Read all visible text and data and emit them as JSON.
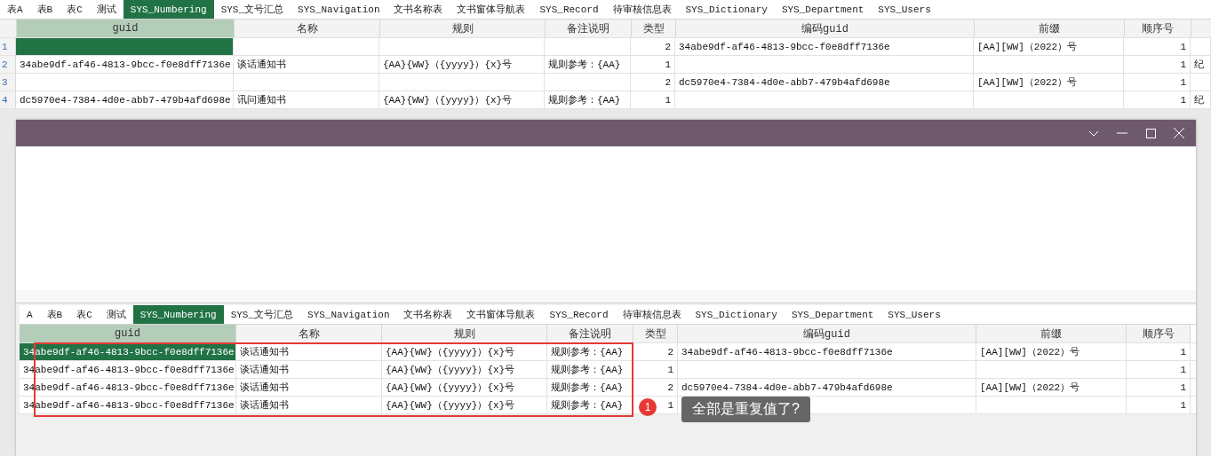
{
  "top_sheet": {
    "tabs": [
      {
        "label": "表A",
        "selected": false
      },
      {
        "label": "表B",
        "selected": false
      },
      {
        "label": "表C",
        "selected": false
      },
      {
        "label": "测试",
        "selected": false
      },
      {
        "label": "SYS_Numbering",
        "selected": true
      },
      {
        "label": "SYS_文号汇总",
        "selected": false
      },
      {
        "label": "SYS_Navigation",
        "selected": false
      },
      {
        "label": "文书名称表",
        "selected": false
      },
      {
        "label": "文书窗体导航表",
        "selected": false
      },
      {
        "label": "SYS_Record",
        "selected": false
      },
      {
        "label": "待审核信息表",
        "selected": false
      },
      {
        "label": "SYS_Dictionary",
        "selected": false
      },
      {
        "label": "SYS_Department",
        "selected": false
      },
      {
        "label": "SYS_Users",
        "selected": false
      }
    ],
    "columns": [
      {
        "label": "guid",
        "selected": true
      },
      {
        "label": "名称",
        "selected": false
      },
      {
        "label": "规则",
        "selected": false
      },
      {
        "label": "备注说明",
        "selected": false
      },
      {
        "label": "类型",
        "selected": false
      },
      {
        "label": "编码guid",
        "selected": false
      },
      {
        "label": "前缀",
        "selected": false
      },
      {
        "label": "顺序号",
        "selected": false
      }
    ],
    "rows": [
      {
        "number": "1",
        "cells": [
          "",
          "",
          "",
          "",
          "2",
          "34abe9df-af46-4813-9bcc-f0e8dff7136e",
          "[AA][WW]（2022）号",
          "1",
          ""
        ],
        "first_cell_selected": true
      },
      {
        "number": "2",
        "cells": [
          "34abe9df-af46-4813-9bcc-f0e8dff7136e",
          "谈话通知书",
          "{AA}{WW}（{yyyy}）{x}号",
          "规则参考：{AA}",
          "1",
          "",
          "",
          "1",
          "纪"
        ],
        "first_cell_selected": false
      },
      {
        "number": "3",
        "cells": [
          "",
          "",
          "",
          "",
          "2",
          "dc5970e4-7384-4d0e-abb7-479b4afd698e",
          "[AA][WW]（2022）号",
          "1",
          ""
        ],
        "first_cell_selected": false
      },
      {
        "number": "4",
        "cells": [
          "dc5970e4-7384-4d0e-abb7-479b4afd698e",
          "讯问通知书",
          "{AA}{WW}（{yyyy}）{x}号",
          "规则参考：{AA}",
          "1",
          "",
          "",
          "1",
          "纪"
        ],
        "first_cell_selected": false
      }
    ]
  },
  "window": {
    "sheet": {
      "tabs": [
        {
          "label": "A",
          "selected": false
        },
        {
          "label": "表B",
          "selected": false
        },
        {
          "label": "表C",
          "selected": false
        },
        {
          "label": "测试",
          "selected": false
        },
        {
          "label": "SYS_Numbering",
          "selected": true
        },
        {
          "label": "SYS_文号汇总",
          "selected": false
        },
        {
          "label": "SYS_Navigation",
          "selected": false
        },
        {
          "label": "文书名称表",
          "selected": false
        },
        {
          "label": "文书窗体导航表",
          "selected": false
        },
        {
          "label": "SYS_Record",
          "selected": false
        },
        {
          "label": "待审核信息表",
          "selected": false
        },
        {
          "label": "SYS_Dictionary",
          "selected": false
        },
        {
          "label": "SYS_Department",
          "selected": false
        },
        {
          "label": "SYS_Users",
          "selected": false
        }
      ],
      "columns": [
        {
          "label": "guid",
          "selected": true
        },
        {
          "label": "名称",
          "selected": false
        },
        {
          "label": "规则",
          "selected": false
        },
        {
          "label": "备注说明",
          "selected": false
        },
        {
          "label": "类型",
          "selected": false
        },
        {
          "label": "编码guid",
          "selected": false
        },
        {
          "label": "前缀",
          "selected": false
        },
        {
          "label": "顺序号",
          "selected": false
        }
      ],
      "rows": [
        {
          "cells": [
            "34abe9df-af46-4813-9bcc-f0e8dff7136e",
            "谈话通知书",
            "{AA}{WW}（{yyyy}）{x}号",
            "规则参考：{AA}",
            "2",
            "34abe9df-af46-4813-9bcc-f0e8dff7136e",
            "[AA][WW]（2022）号",
            "1"
          ],
          "first_cell_selected": true
        },
        {
          "cells": [
            "34abe9df-af46-4813-9bcc-f0e8dff7136e",
            "谈话通知书",
            "{AA}{WW}（{yyyy}）{x}号",
            "规则参考：{AA}",
            "1",
            "",
            "",
            "1"
          ],
          "first_cell_selected": false
        },
        {
          "cells": [
            "34abe9df-af46-4813-9bcc-f0e8dff7136e",
            "谈话通知书",
            "{AA}{WW}（{yyyy}）{x}号",
            "规则参考：{AA}",
            "2",
            "dc5970e4-7384-4d0e-abb7-479b4afd698e",
            "[AA][WW]（2022）号",
            "1"
          ],
          "first_cell_selected": false
        },
        {
          "cells": [
            "34abe9df-af46-4813-9bcc-f0e8dff7136e",
            "谈话通知书",
            "{AA}{WW}（{yyyy}）{x}号",
            "规则参考：{AA}",
            "1",
            "",
            "",
            "1"
          ],
          "first_cell_selected": false
        }
      ]
    },
    "callout": {
      "number": "1",
      "text": "全部是重复值了?"
    }
  }
}
